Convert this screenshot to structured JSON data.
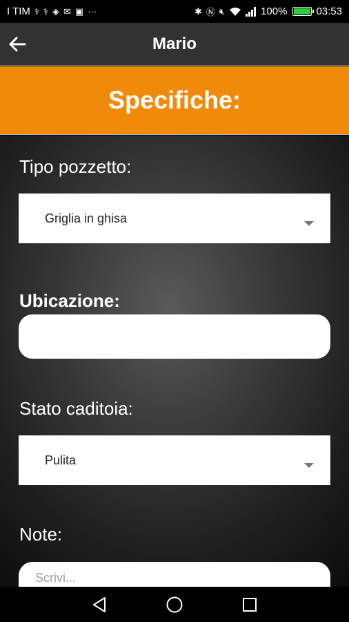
{
  "status_bar": {
    "carrier": "I TIM",
    "left_icons": [
      "usb-icon",
      "usb-icon",
      "location-icon",
      "mail-icon",
      "app-icon",
      "more-icon"
    ],
    "right_icons": [
      "bluetooth-icon",
      "nfc-icon",
      "mute-icon",
      "wifi-icon",
      "signal-icon"
    ],
    "battery_percent": "100%",
    "battery_level": 1.0,
    "time": "03:53"
  },
  "app_bar": {
    "title": "Mario"
  },
  "section": {
    "title": "Specifiche:"
  },
  "form": {
    "tipo_pozzetto": {
      "label": "Tipo pozzetto:",
      "selected": "Griglia in ghisa"
    },
    "ubicazione": {
      "label": "Ubicazione:",
      "value": "",
      "placeholder": ""
    },
    "stato_caditoia": {
      "label": "Stato caditoia:",
      "selected": "Pulita"
    },
    "note": {
      "label": "Note:",
      "value": "",
      "placeholder": "Scrivi..."
    }
  },
  "colors": {
    "accent": "#f18a09",
    "app_bar": "#323232",
    "battery": "#2ecc40"
  }
}
